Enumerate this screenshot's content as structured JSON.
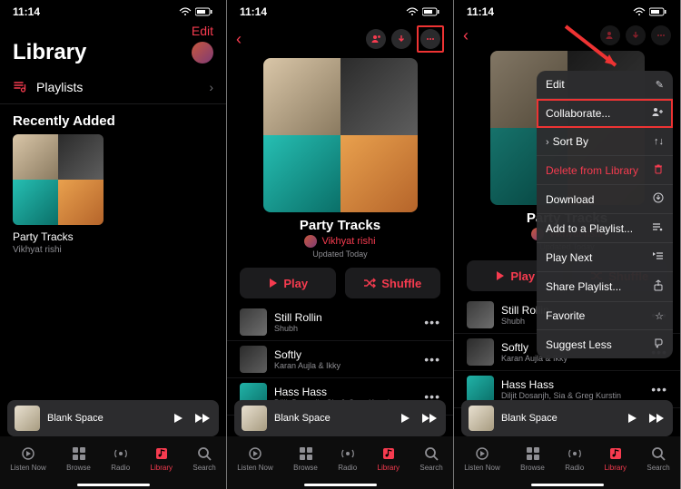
{
  "status": {
    "time": "11:14"
  },
  "library": {
    "edit": "Edit",
    "title": "Library",
    "playlists_label": "Playlists",
    "recently_added": "Recently Added",
    "album": {
      "name": "Party Tracks",
      "artist": "Vikhyat rishi"
    }
  },
  "playlist": {
    "name": "Party Tracks",
    "author": "Vikhyat rishi",
    "updated": "Updated Today",
    "play": "Play",
    "shuffle": "Shuffle",
    "tracks": [
      {
        "title": "Still Rollin",
        "artist": "Shubh"
      },
      {
        "title": "Softly",
        "artist": "Karan Aujla & Ikky"
      },
      {
        "title": "Hass Hass",
        "artist": "Diljit Dosanjh, Sia & Greg Kurstin"
      }
    ]
  },
  "nowplaying": {
    "title": "Blank Space"
  },
  "tabs": {
    "listen": "Listen Now",
    "browse": "Browse",
    "radio": "Radio",
    "library": "Library",
    "search": "Search"
  },
  "menu": {
    "edit": "Edit",
    "collaborate": "Collaborate...",
    "sort": "Sort By",
    "delete": "Delete from Library",
    "download": "Download",
    "addplaylist": "Add to a Playlist...",
    "playnext": "Play Next",
    "share": "Share Playlist...",
    "favorite": "Favorite",
    "suggestless": "Suggest Less"
  }
}
